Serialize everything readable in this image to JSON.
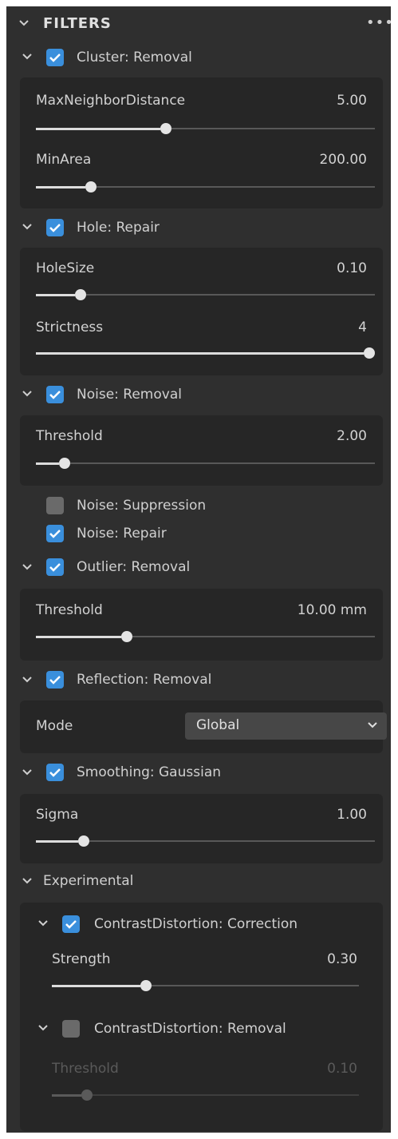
{
  "header": {
    "title": "FILTERS",
    "more": "•••"
  },
  "filters": {
    "cluster": {
      "label": "Cluster: Removal",
      "params": [
        {
          "name": "MaxNeighborDistance",
          "value": "5.00",
          "fraction": 0.38
        },
        {
          "name": "MinArea",
          "value": "200.00",
          "fraction": 0.15
        }
      ]
    },
    "hole": {
      "label": "Hole: Repair",
      "params": [
        {
          "name": "HoleSize",
          "value": "0.10",
          "fraction": 0.12
        },
        {
          "name": "Strictness",
          "value": "4",
          "fraction": 1.0
        }
      ]
    },
    "noise": {
      "label": "Noise: Removal",
      "params": [
        {
          "name": "Threshold",
          "value": "2.00",
          "fraction": 0.07
        }
      ],
      "suppression_label": "Noise: Suppression",
      "repair_label": "Noise: Repair"
    },
    "outlier": {
      "label": "Outlier: Removal",
      "params": [
        {
          "name": "Threshold",
          "value": "10.00 mm",
          "fraction": 0.26
        }
      ]
    },
    "reflection": {
      "label": "Reflection: Removal",
      "mode_label": "Mode",
      "mode_value": "Global"
    },
    "smoothing": {
      "label": "Smoothing: Gaussian",
      "params": [
        {
          "name": "Sigma",
          "value": "1.00",
          "fraction": 0.13
        }
      ]
    },
    "experimental": {
      "label": "Experimental",
      "contrast_correction": {
        "label": "ContrastDistortion: Correction",
        "params": [
          {
            "name": "Strength",
            "value": "0.30",
            "fraction": 0.3
          }
        ]
      },
      "contrast_removal": {
        "label": "ContrastDistortion: Removal",
        "params": [
          {
            "name": "Threshold",
            "value": "0.10",
            "fraction": 0.1
          }
        ]
      }
    }
  },
  "colors": {
    "panel": "#2f2f2f",
    "group": "#262626",
    "checkbox_on": "#3a8fdc",
    "checkbox_off": "#6a6a6a"
  }
}
